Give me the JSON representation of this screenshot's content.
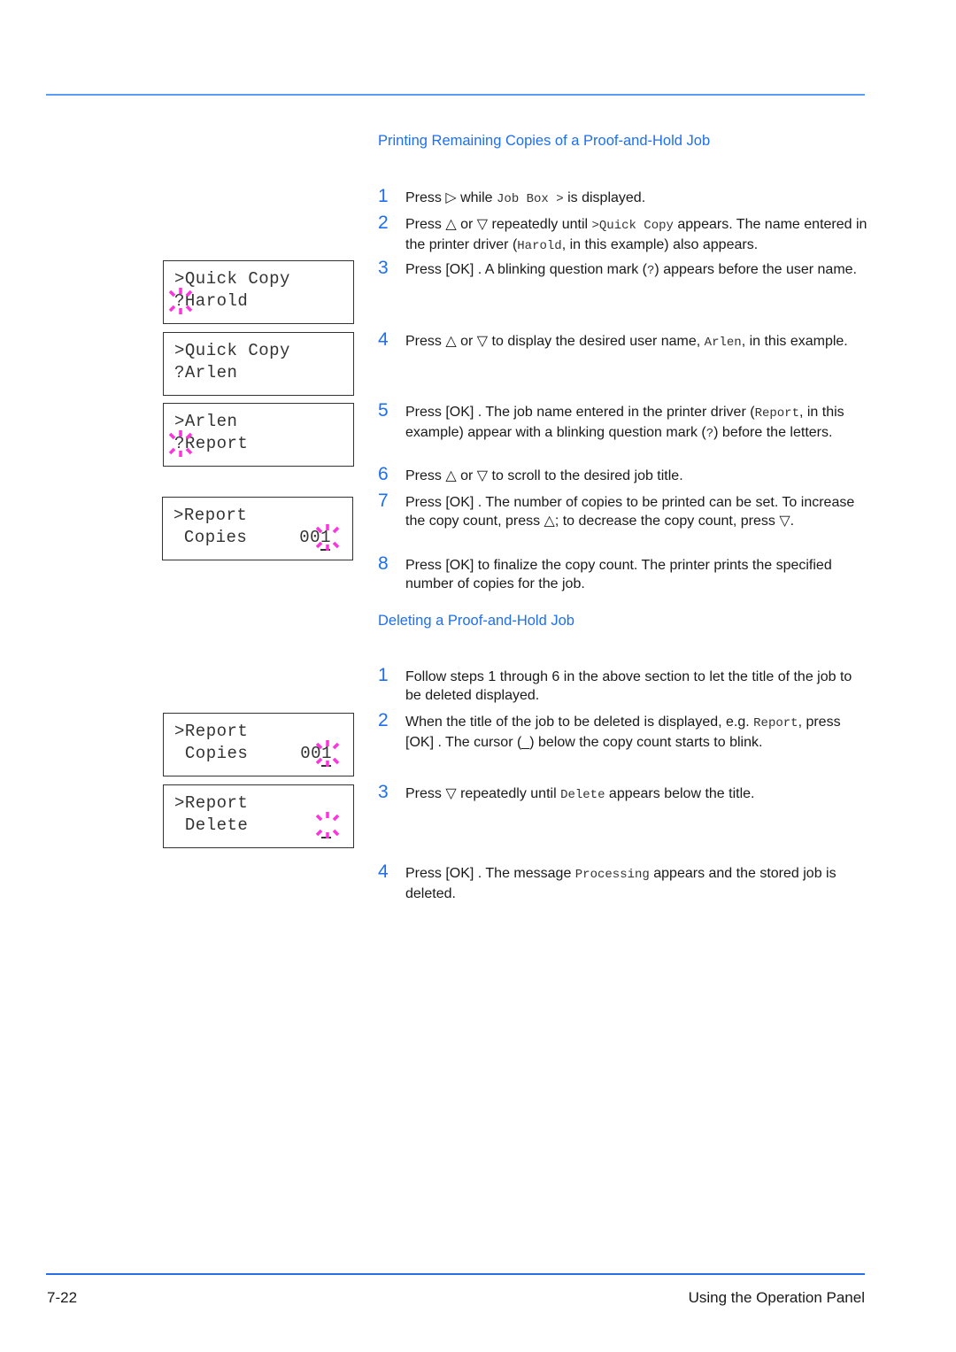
{
  "header": {},
  "sections": [
    {
      "title": "Printing Remaining Copies of a Proof-and-Hold Job",
      "steps": [
        {
          "num": "1",
          "parts": [
            "Press ",
            "▷",
            " while ",
            {
              "mono": "Job Box >"
            },
            " is displayed."
          ]
        },
        {
          "num": "2",
          "parts": [
            "Press ",
            "△",
            " or ",
            "▽",
            " repeatedly until ",
            {
              "mono": ">Quick Copy"
            },
            " appears. The name entered in the printer driver (",
            {
              "mono": "Harold"
            },
            ", in this example) also appears."
          ]
        },
        {
          "num": "3",
          "parts": [
            "Press [OK] . A blinking question mark (",
            {
              "mono": "?"
            },
            ") appears before the user name."
          ]
        },
        {
          "num": "4",
          "parts": [
            "Press ",
            "△",
            " or ",
            "▽",
            " to display the desired user name, ",
            {
              "mono": "Arlen"
            },
            ", in this example."
          ]
        },
        {
          "num": "5",
          "parts": [
            "Press [OK] . The job name entered in the printer driver (",
            {
              "mono": "Report"
            },
            ", in this example) appear with a blinking question mark (",
            {
              "mono": "?"
            },
            ") before the letters."
          ]
        },
        {
          "num": "6",
          "parts": [
            "Press ",
            "△",
            " or ",
            "▽",
            " to scroll to the desired job title."
          ]
        },
        {
          "num": "7",
          "parts": [
            "Press [OK] . The number of copies to be printed can be set. To increase the copy count, press ",
            "△",
            "; to decrease the copy count, press ",
            "▽",
            "."
          ]
        },
        {
          "num": "8",
          "parts": [
            "Press [OK]  to finalize the copy count. The printer prints the specified number of copies for the job."
          ]
        }
      ]
    },
    {
      "title": "Deleting a Proof-and-Hold Job",
      "steps": [
        {
          "num": "1",
          "parts": [
            "Follow steps 1 through 6 in the above section to let the title of the job to be deleted displayed."
          ]
        },
        {
          "num": "2",
          "parts": [
            "When the title of the job to be deleted is displayed, e.g. ",
            {
              "mono": "Report"
            },
            ", press [OK] . The cursor (_) below the copy count starts to blink."
          ]
        },
        {
          "num": "3",
          "parts": [
            "Press ",
            "▽",
            " repeatedly until ",
            {
              "mono": "Delete"
            },
            " appears below the title."
          ]
        },
        {
          "num": "4",
          "parts": [
            "Press [OK] . The message ",
            {
              "mono": "Processing"
            },
            " appears and the stored job is deleted."
          ]
        }
      ]
    }
  ],
  "lcd_displays": [
    {
      "line1": ">Quick Copy",
      "line2": "?Harold",
      "value": "",
      "blink": "question"
    },
    {
      "line1": ">Quick Copy",
      "line2": "?Arlen",
      "value": "",
      "blink": "none"
    },
    {
      "line1": ">Arlen",
      "line2": "?Report",
      "value": "",
      "blink": "question"
    },
    {
      "line1": ">Report",
      "line2": " Copies",
      "value": "001",
      "blink": "value"
    },
    {
      "line1": ">Report",
      "line2": " Copies",
      "value": "001",
      "blink": "value"
    },
    {
      "line1": ">Report",
      "line2": " Delete",
      "value": "",
      "blink": "cursor"
    }
  ],
  "footer": {
    "page_number": "7-22",
    "chapter_title": "Using the Operation Panel"
  },
  "colors": {
    "accent": "#1e6ff0",
    "rule_top": "#5b9cf5",
    "rule_bottom": "#2a6fe8",
    "blink": "#ff33dd"
  }
}
